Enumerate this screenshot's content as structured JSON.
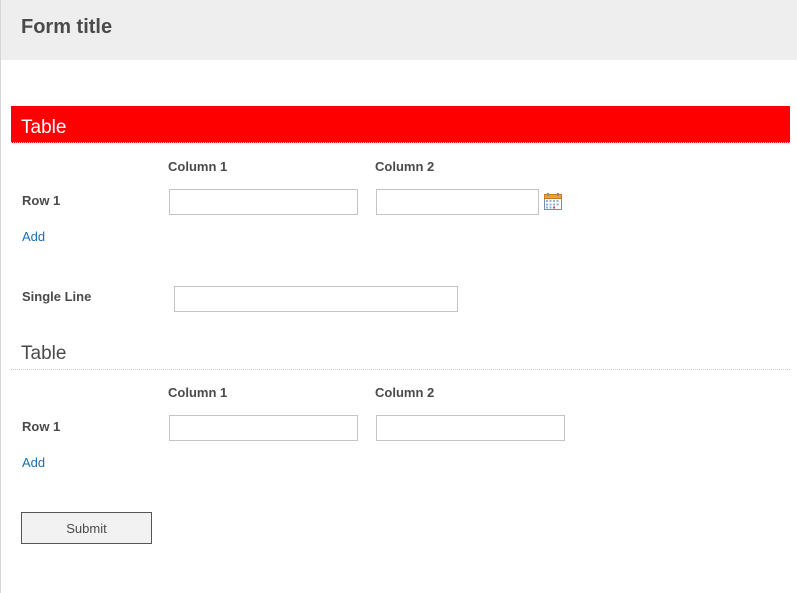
{
  "form": {
    "title": "Form title"
  },
  "section1": {
    "title": "Table",
    "columns": [
      "Column 1",
      "Column 2"
    ],
    "rows": [
      {
        "label": "Row 1",
        "col1_value": "",
        "col2_value": ""
      }
    ],
    "add_link": "Add",
    "column2_icon": "calendar-icon",
    "header_color": "#ff0000"
  },
  "single_line": {
    "label": "Single Line",
    "value": ""
  },
  "section2": {
    "title": "Table",
    "columns": [
      "Column 1",
      "Column 2"
    ],
    "rows": [
      {
        "label": "Row 1",
        "col1_value": "",
        "col2_value": ""
      }
    ],
    "add_link": "Add"
  },
  "submit": {
    "label": "Submit"
  },
  "colors": {
    "header_bg": "#eeeeee",
    "link": "#1a6fb5",
    "text": "#4a4a4a"
  }
}
